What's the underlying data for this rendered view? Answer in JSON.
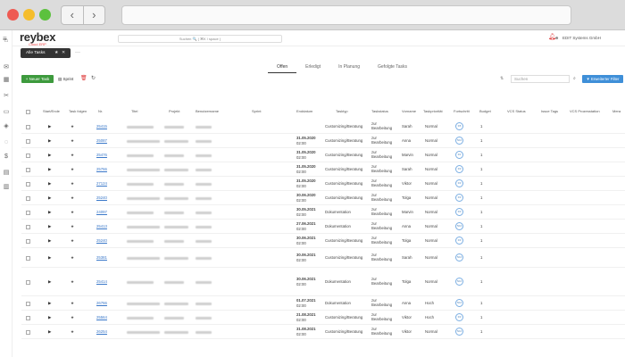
{
  "app": {
    "logo": "reybex",
    "logo_sub": "Cloud ERP",
    "search_placeholder": "Suchen  🔍  ( ⌘K / space )",
    "company": "EDIT Systems GmbH",
    "notification_count": "1"
  },
  "tabs": [
    {
      "label": "Alle Tasks"
    }
  ],
  "subtabs": [
    {
      "label": "Offen"
    },
    {
      "label": "Erledigt"
    },
    {
      "label": "In Planung"
    },
    {
      "label": "Gefolgte Tasks"
    }
  ],
  "toolbar": {
    "new_label": "+ Neuer Task",
    "sprint_label": "Sprint",
    "search_placeholder": "Suchen",
    "filter_label": "Erweiterter Filter"
  },
  "columns": [
    "Start/Ende",
    "Task folgen",
    "Nr.",
    "Titel",
    "Projekt",
    "Benutzername",
    "Sprint",
    "Enddatum",
    "Tasktyp",
    "Taskstatus",
    "Vorname",
    "Taskpriorität",
    "Fortschritt",
    "Budget",
    "VCS Status",
    "Issue Tags",
    "VCS Prozesstation",
    "Mera"
  ],
  "rows": [
    {
      "nr": "25415",
      "date": "",
      "time": "",
      "type": "Customizing/Beratung",
      "status": "zur Bearbeitung",
      "vorname": "Sarah",
      "prio": "Normal",
      "prog": "0/5",
      "budget": "1"
    },
    {
      "nr": "25087",
      "date": "31.05.2020",
      "time": "02:00",
      "type": "Customizing/Beratung",
      "status": "zur Bearbeitung",
      "vorname": "Anna",
      "prio": "Normal",
      "prog": "5/10",
      "budget": "1"
    },
    {
      "nr": "25476",
      "date": "31.05.2020",
      "time": "02:00",
      "type": "Customizing/Beratung",
      "status": "zur Bearbeitung",
      "vorname": "Marvin",
      "prio": "Normal",
      "prog": "0/1",
      "budget": "1"
    },
    {
      "nr": "25766",
      "date": "31.05.2020",
      "time": "02:00",
      "type": "Customizing/Beratung",
      "status": "zur Bearbeitung",
      "vorname": "Sarah",
      "prio": "Normal",
      "prog": "0/0",
      "budget": "1"
    },
    {
      "nr": "27124",
      "date": "31.05.2020",
      "time": "02:00",
      "type": "Customizing/Beratung",
      "status": "zur Bearbeitung",
      "vorname": "Viktor",
      "prio": "Normal",
      "prog": "0/0",
      "budget": "1"
    },
    {
      "nr": "25240",
      "date": "30.06.2020",
      "time": "02:00",
      "type": "Customizing/Beratung",
      "status": "zur Bearbeitung",
      "vorname": "Tolga",
      "prio": "Normal",
      "prog": "0/0",
      "budget": "1"
    },
    {
      "nr": "24097",
      "date": "30.05.2021",
      "time": "02:00",
      "type": "Dokumentation",
      "status": "zur Bearbeitung",
      "vorname": "Marvin",
      "prio": "Normal",
      "prog": "0/0",
      "budget": "1"
    },
    {
      "nr": "25413",
      "date": "27.06.2021",
      "time": "02:00",
      "type": "Dokumentation",
      "status": "zur Bearbeitung",
      "vorname": "Anna",
      "prio": "Normal",
      "prog": "5/10",
      "budget": "1"
    },
    {
      "nr": "25240",
      "date": "30.06.2021",
      "time": "02:00",
      "type": "Customizing/Beratung",
      "status": "zur Bearbeitung",
      "vorname": "Tolga",
      "prio": "Normal",
      "prog": "0/0",
      "budget": "1"
    },
    {
      "nr": "25381",
      "date": "30.06.2021",
      "time": "02:00",
      "type": "Customizing/Beratung",
      "status": "zur Bearbeitung",
      "vorname": "Sarah",
      "prio": "Normal",
      "prog": "5/10",
      "budget": "1"
    },
    {
      "nr": "25414",
      "date": "30.06.2021",
      "time": "02:00",
      "type": "Dokumentation",
      "status": "zur Bearbeitung",
      "vorname": "Tolga",
      "prio": "Normal",
      "prog": "5/10",
      "budget": "1"
    },
    {
      "nr": "26766",
      "date": "01.07.2021",
      "time": "02:00",
      "type": "Dokumentation",
      "status": "zur Bearbeitung",
      "vorname": "Anna",
      "prio": "Hoch",
      "prog": "5/10",
      "budget": "1"
    },
    {
      "nr": "25564",
      "date": "21.08.2021",
      "time": "02:00",
      "type": "Customizing/Beratung",
      "status": "zur Bearbeitung",
      "vorname": "Viktor",
      "prio": "Hoch",
      "prog": "0/0",
      "budget": "1"
    },
    {
      "nr": "26254",
      "date": "31.08.2021",
      "time": "02:00",
      "type": "Customizing/Beratung",
      "status": "zur Bearbeitung",
      "vorname": "Viktor",
      "prio": "Normal",
      "prog": "5/10",
      "budget": "1"
    }
  ],
  "icons": {
    "menu": "hamburger-icon",
    "bell": "bell-icon",
    "play": "play-icon",
    "star": "star-icon",
    "refresh": "refresh-icon",
    "trash": "trash-icon"
  },
  "colors": {
    "new_button": "#3d9a3d",
    "filter_button": "#3f8fd8",
    "link": "#3a78c9"
  }
}
